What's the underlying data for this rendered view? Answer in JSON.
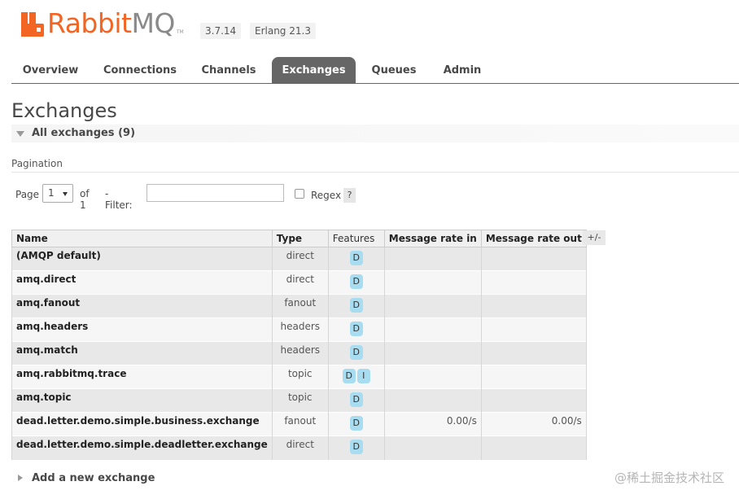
{
  "header": {
    "logo_brand": "Rabbit",
    "logo_suffix": "MQ",
    "logo_tm": "TM",
    "version": "3.7.14",
    "erlang": "Erlang 21.3"
  },
  "nav": {
    "tabs": [
      {
        "label": "Overview"
      },
      {
        "label": "Connections"
      },
      {
        "label": "Channels"
      },
      {
        "label": "Exchanges",
        "active": true
      },
      {
        "label": "Queues"
      },
      {
        "label": "Admin"
      }
    ]
  },
  "page": {
    "title": "Exchanges",
    "section_label": "All exchanges (9)"
  },
  "pagination": {
    "heading": "Pagination",
    "page_label": "Page",
    "page_value": "1",
    "of_label": "of 1",
    "filter_label": "- Filter:",
    "filter_value": "",
    "regex_label": "Regex",
    "help_label": "?"
  },
  "table": {
    "columns": [
      "Name",
      "Type",
      "Features",
      "Message rate in",
      "Message rate out"
    ],
    "toggle_label": "+/-",
    "rows": [
      {
        "name": "(AMQP default)",
        "type": "direct",
        "features": [
          "D"
        ],
        "rate_in": "",
        "rate_out": ""
      },
      {
        "name": "amq.direct",
        "type": "direct",
        "features": [
          "D"
        ],
        "rate_in": "",
        "rate_out": ""
      },
      {
        "name": "amq.fanout",
        "type": "fanout",
        "features": [
          "D"
        ],
        "rate_in": "",
        "rate_out": ""
      },
      {
        "name": "amq.headers",
        "type": "headers",
        "features": [
          "D"
        ],
        "rate_in": "",
        "rate_out": ""
      },
      {
        "name": "amq.match",
        "type": "headers",
        "features": [
          "D"
        ],
        "rate_in": "",
        "rate_out": ""
      },
      {
        "name": "amq.rabbitmq.trace",
        "type": "topic",
        "features": [
          "D",
          "I"
        ],
        "rate_in": "",
        "rate_out": ""
      },
      {
        "name": "amq.topic",
        "type": "topic",
        "features": [
          "D"
        ],
        "rate_in": "",
        "rate_out": ""
      },
      {
        "name": "dead.letter.demo.simple.business.exchange",
        "type": "fanout",
        "features": [
          "D"
        ],
        "rate_in": "0.00/s",
        "rate_out": "0.00/s"
      },
      {
        "name": "dead.letter.demo.simple.deadletter.exchange",
        "type": "direct",
        "features": [
          "D"
        ],
        "rate_in": "",
        "rate_out": ""
      }
    ]
  },
  "footer": {
    "add_label": "Add a new exchange",
    "watermark": "@稀土掘金技术社区"
  },
  "colors": {
    "brand_orange": "#f26522",
    "feature_badge": "#a8dcf0",
    "active_tab": "#666666"
  }
}
